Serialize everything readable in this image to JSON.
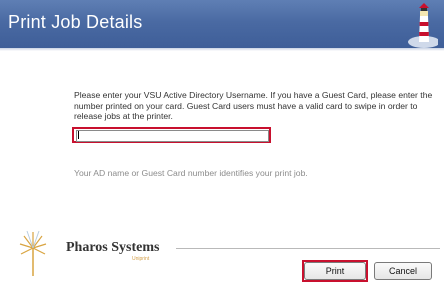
{
  "window": {
    "title": "Print Job Details"
  },
  "form": {
    "instructions": "Please enter your VSU Active Directory Username.  If you have a Guest Card, please enter the number printed on your card.  Guest Card users must have a valid card to swipe in order to release jobs at the printer.",
    "username_value": "",
    "hint": "Your AD name or Guest Card number identifies your print job."
  },
  "branding": {
    "name": "Pharos Systems",
    "tagline": "Uniprint"
  },
  "buttons": {
    "print_label": "Print",
    "cancel_label": "Cancel"
  },
  "colors": {
    "titlebar": "#4a6aa3",
    "highlight": "#c8102e",
    "logo_accent": "#d4a04a"
  },
  "icons": {
    "title_icon": "lighthouse-icon",
    "logo_icon": "pharos-burst-icon"
  }
}
